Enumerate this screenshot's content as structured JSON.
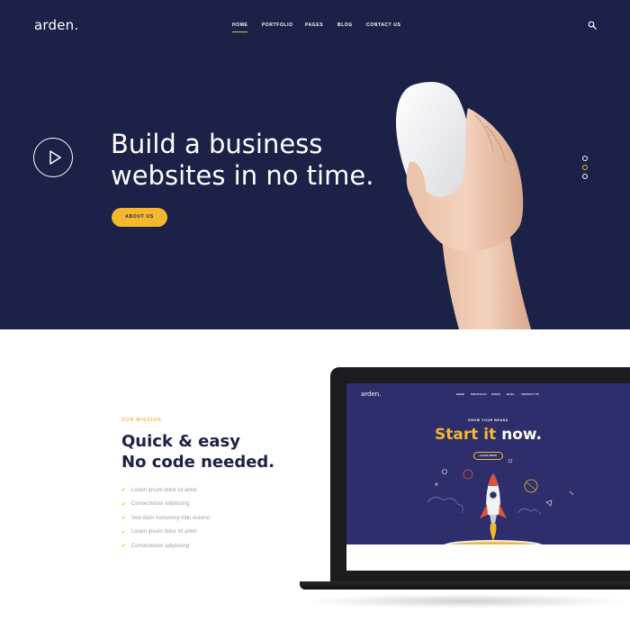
{
  "header": {
    "logo": "arden.",
    "nav": [
      {
        "label": "HOME",
        "active": true
      },
      {
        "label": "PORTFOLIO",
        "active": false
      },
      {
        "label": "PAGES",
        "active": false
      },
      {
        "label": "BLOG",
        "active": false
      },
      {
        "label": "CONTACT US",
        "active": false
      }
    ],
    "search_icon": "search-icon"
  },
  "hero": {
    "title_line1": "Build a business",
    "title_line2": "websites in no time.",
    "button_label": "ABOUT US",
    "play_icon": "play-icon",
    "slider_dots": 3,
    "active_dot": 2
  },
  "mission": {
    "eyebrow": "OUR MISSION",
    "title_line1": "Quick & easy",
    "title_line2": "No code needed.",
    "features": [
      "Lorem ipsum dolor sit amet",
      "Consectetuer adipiscing",
      "Sed diam nonummy nibh euismo",
      "Lorem ipsum dolor sit amet",
      "Consectetuer adipiscing"
    ]
  },
  "mockup": {
    "logo": "arden.",
    "nav": [
      "HOME",
      "PORTFOLIO",
      "PAGES",
      "BLOG",
      "CONTACT US"
    ],
    "eyebrow": "GROW YOUR BRAND",
    "title_accent": "Start it",
    "title_rest": "now.",
    "button_label": "LEARN MORE"
  },
  "colors": {
    "navy": "#1b2147",
    "accent": "#f3b82b",
    "muted_text": "#9aa0b3",
    "mockup_bg": "#2d2e6b"
  }
}
